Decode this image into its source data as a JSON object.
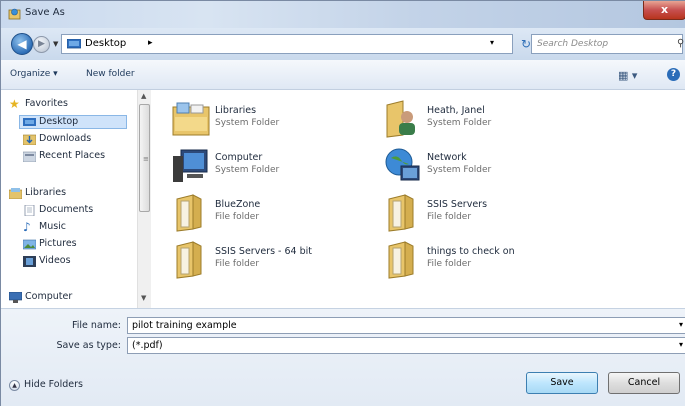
{
  "window": {
    "title": "Save As",
    "close_label": "x"
  },
  "address": {
    "location": "Desktop",
    "search_placeholder": "Search Desktop"
  },
  "toolbar": {
    "organize": "Organize ▾",
    "new_folder": "New folder"
  },
  "nav": {
    "favorites": "Favorites",
    "desktop": "Desktop",
    "downloads": "Downloads",
    "recent_places": "Recent Places",
    "libraries": "Libraries",
    "documents": "Documents",
    "music": "Music",
    "pictures": "Pictures",
    "videos": "Videos",
    "computer": "Computer"
  },
  "files": [
    {
      "name": "Libraries",
      "type": "System Folder",
      "icon": "libraries-icon"
    },
    {
      "name": "Heath, Janel",
      "type": "System Folder",
      "icon": "user-folder-icon"
    },
    {
      "name": "Computer",
      "type": "System Folder",
      "icon": "computer-icon"
    },
    {
      "name": "Network",
      "type": "System Folder",
      "icon": "network-icon"
    },
    {
      "name": "BlueZone",
      "type": "File folder",
      "icon": "folder-icon"
    },
    {
      "name": "SSIS Servers",
      "type": "File folder",
      "icon": "folder-icon"
    },
    {
      "name": "SSIS Servers - 64 bit",
      "type": "File folder",
      "icon": "folder-icon"
    },
    {
      "name": "things to check on",
      "type": "File folder",
      "icon": "folder-icon"
    }
  ],
  "form": {
    "file_name_label": "File name:",
    "file_name_value": "pilot training example",
    "save_type_label": "Save as type:",
    "save_type_value": "(*.pdf)"
  },
  "footer": {
    "hide_folders": "Hide Folders",
    "save": "Save",
    "cancel": "Cancel"
  },
  "colors": {
    "accent": "#2f6fb7",
    "selection": "#cfe3fa",
    "close": "#c75050"
  }
}
